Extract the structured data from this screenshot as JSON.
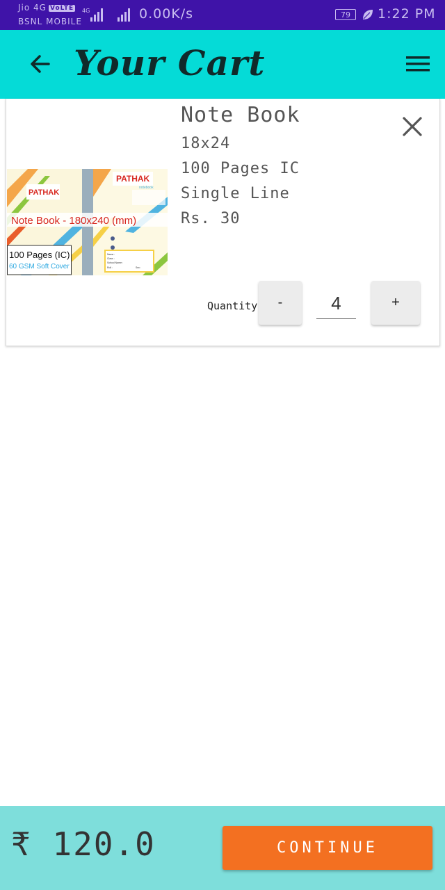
{
  "status_bar": {
    "carrier_primary": "Jio 4G",
    "volte": "VoLTE",
    "carrier_secondary": "BSNL MOBILE",
    "network_type": "4G",
    "speed": "0.00K/s",
    "battery": "79",
    "time": "1:22 PM"
  },
  "app_bar": {
    "title": "Your Cart"
  },
  "cart_item": {
    "name": "Note Book",
    "size": "18x24",
    "pages": "100 Pages IC",
    "ruling": "Single Line",
    "price": "Rs. 30",
    "quantity_label": "Quantity:",
    "quantity": "4",
    "minus_label": "-",
    "plus_label": "+",
    "image": {
      "brand": "PATHAK",
      "sub_brand": "notebook",
      "caption": "Note Book - 180x240 (mm)",
      "pages_text": "100 Pages (IC)",
      "cover_text": "60 GSM Soft Cover",
      "form_name": "Name :",
      "form_class": "Class :",
      "form_school": "School Name :",
      "form_roll": "Roll :",
      "form_sec": "Sec :"
    }
  },
  "bottom_bar": {
    "total": "₹ 120.0",
    "continue_label": "CONTINUE"
  },
  "colors": {
    "status_bar": "#3f13a8",
    "app_bar": "#05dbd7",
    "bottom_bar": "#7ededb",
    "continue": "#f37021"
  }
}
